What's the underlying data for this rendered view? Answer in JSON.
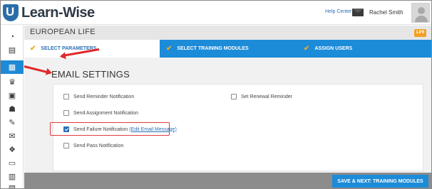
{
  "app": {
    "logo_text": "Learn-Wise",
    "help_label": "Help Center",
    "user_name": "Rachel Smith"
  },
  "rail": {
    "items": [
      {
        "icon": "dashboard-icon",
        "glyph": "◔"
      },
      {
        "icon": "book-icon",
        "glyph": "▤"
      },
      {
        "icon": "assignments-grid-icon",
        "glyph": "▦"
      },
      {
        "icon": "trophy-icon",
        "glyph": "♛"
      },
      {
        "icon": "presentation-icon",
        "glyph": "▣"
      },
      {
        "icon": "users-icon",
        "glyph": "☗"
      },
      {
        "icon": "pencil-edit-icon",
        "glyph": "✎"
      },
      {
        "icon": "envelope-icon",
        "glyph": "✉"
      },
      {
        "icon": "certificate-icon",
        "glyph": "❖"
      },
      {
        "icon": "document-icon",
        "glyph": "▭"
      },
      {
        "icon": "bar-chart-icon",
        "glyph": "▥"
      },
      {
        "icon": "reports-icon",
        "glyph": "▧"
      }
    ],
    "active_index": 2
  },
  "page": {
    "org_title": "EUROPEAN LIFE",
    "badge": "LP9"
  },
  "steps": [
    {
      "label": "SELECT PARAMETERS",
      "active": true
    },
    {
      "label": "SELECT TRAINING MODULES",
      "active": false
    },
    {
      "label": "ASSIGN USERS",
      "active": false
    }
  ],
  "email_settings": {
    "heading": "EMAIL SETTINGS",
    "options": [
      {
        "label": "Send Reminder Notification",
        "checked": false
      },
      {
        "label": "Set Renewal Reminder",
        "checked": false
      },
      {
        "label": "Send Assignment Notification",
        "checked": false
      },
      {
        "label": "Send Failure Notification",
        "checked": true,
        "link": "(Edit Email Message)"
      },
      {
        "label": "Send Pass Notification",
        "checked": false
      }
    ]
  },
  "footer": {
    "save_label": "SAVE & NEXT: TRAINING MODULES"
  },
  "colors": {
    "accent": "#1c8bd8",
    "check": "#f2a623",
    "badge": "#f0a020",
    "annotation": "#e02828"
  }
}
